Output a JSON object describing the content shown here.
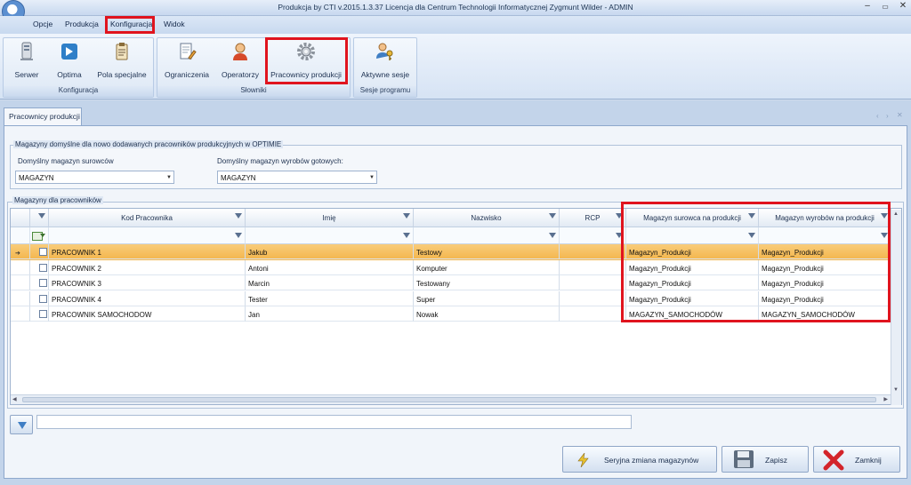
{
  "window": {
    "title": "Produkcja by CTI v.2015.1.3.37 Licencja dla Centrum Technologii Informatycznej Zygmunt Wilder - ADMIN"
  },
  "menu": [
    "Opcje",
    "Produkcja",
    "Konfiguracja",
    "Widok"
  ],
  "ribbon": {
    "groups": [
      {
        "label": "Konfiguracja",
        "buttons": [
          "Serwer",
          "Optima",
          "Pola specjalne"
        ]
      },
      {
        "label": "Słowniki",
        "buttons": [
          "Ograniczenia",
          "Operatorzy",
          "Pracownicy produkcji"
        ]
      },
      {
        "label": "Sesje programu",
        "buttons": [
          "Aktywne sesje"
        ]
      }
    ]
  },
  "tab": {
    "label": "Pracownicy produkcji"
  },
  "defaults": {
    "legend": "Magazyny domyślne dla nowo dodawanych pracowników produkcyjnych w OPTIMIE",
    "raw_label": "Domyślny magazyn surowców",
    "raw_value": "MAGAZYN",
    "finished_label": "Domyślny magazyn wyrobów gotowych:",
    "finished_value": "MAGAZYN"
  },
  "grid": {
    "legend": "Magazyny dla pracowników",
    "columns": [
      "Kod Pracownika",
      "Imię",
      "Nazwisko",
      "RCP",
      "Magazyn surowca na produkcji",
      "Magazyn wyrobów na produkcji"
    ],
    "rows": [
      {
        "kod": "PRACOWNIK 1",
        "imie": "Jakub",
        "nazwisko": "Testowy",
        "rcp": "",
        "surowca": "Magazyn_Produkcji",
        "wyrobow": "Magazyn_Produkcji"
      },
      {
        "kod": "PRACOWNIK 2",
        "imie": "Antoni",
        "nazwisko": "Komputer",
        "rcp": "",
        "surowca": "Magazyn_Produkcji",
        "wyrobow": "Magazyn_Produkcji"
      },
      {
        "kod": "PRACOWNIK 3",
        "imie": "Marcin",
        "nazwisko": "Testowany",
        "rcp": "",
        "surowca": "Magazyn_Produkcji",
        "wyrobow": "Magazyn_Produkcji"
      },
      {
        "kod": "PRACOWNIK 4",
        "imie": "Tester",
        "nazwisko": "Super",
        "rcp": "",
        "surowca": "Magazyn_Produkcji",
        "wyrobow": "Magazyn_Produkcji"
      },
      {
        "kod": "PRACOWNIK SAMOCHODOW",
        "imie": "Jan",
        "nazwisko": "Nowak",
        "rcp": "",
        "surowca": "MAGAZYN_SAMOCHODÓW",
        "wyrobow": "MAGAZYN_SAMOCHODÓW"
      }
    ]
  },
  "buttons": {
    "bulk": "Seryjna zmiana magazynów",
    "save": "Zapisz",
    "close": "Zamknij"
  },
  "colors": {
    "highlight": "#e0141e",
    "selected_row": "#f5b94f"
  }
}
